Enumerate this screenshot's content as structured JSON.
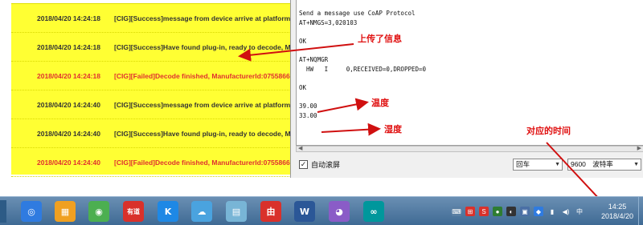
{
  "log": {
    "rows": [
      {
        "timestamp": "2018/04/20 14:24:18",
        "message": "[CIG][Success]message from device arrive at platform, ",
        "status": "success"
      },
      {
        "timestamp": "2018/04/20 14:24:18",
        "message": "[CIG][Success]Have found plug-in, ready to decode, Ma",
        "status": "success"
      },
      {
        "timestamp": "2018/04/20 14:24:18",
        "message": "[CIG][Failed]Decode finished, ManufacturerId:07558661",
        "status": "failed"
      },
      {
        "timestamp": "2018/04/20 14:24:40",
        "message": "[CIG][Success]message from device arrive at platform, ",
        "status": "success"
      },
      {
        "timestamp": "2018/04/20 14:24:40",
        "message": "[CIG][Success]Have found plug-in, ready to decode, Ma",
        "status": "success"
      },
      {
        "timestamp": "2018/04/20 14:24:40",
        "message": "[CIG][Failed]Decode finished, ManufacturerId:07558661",
        "status": "failed"
      }
    ]
  },
  "terminal": {
    "lines": [
      "Send a message use CoAP Protocol",
      "AT+NMGS=3,020103",
      "",
      "OK",
      "",
      "AT+NQMGR",
      "  HW   I     0,RECEIVED=0,DROPPED=0",
      "",
      "OK",
      "",
      "39.00",
      "33.00"
    ],
    "auto_scroll_label": "自动滚屏",
    "auto_scroll_checked": true,
    "line_ending": "回车",
    "baud_value": "9600",
    "baud_label": "波特率"
  },
  "annotations": {
    "uploaded_info": "上传了信息",
    "temperature": "温度",
    "humidity": "湿度",
    "corresponding_time": "对应的时间"
  },
  "taskbar": {
    "apps": [
      {
        "icon": "baidu-netdisk-icon",
        "glyph": "◎",
        "color": "#2f7be0"
      },
      {
        "icon": "app-store-icon",
        "glyph": "▦",
        "color": "#f0a020"
      },
      {
        "icon": "chrome-icon",
        "glyph": "◉",
        "color": "#4caf50"
      },
      {
        "icon": "youdao-dictionary-icon",
        "glyph": "有道",
        "color": "#d9312b"
      },
      {
        "icon": "kugou-icon",
        "glyph": "K",
        "color": "#1e88e5"
      },
      {
        "icon": "cloud-icon",
        "glyph": "☁",
        "color": "#4aa3df"
      },
      {
        "icon": "notes-icon",
        "glyph": "▤",
        "color": "#78b5d6"
      },
      {
        "icon": "app-red-icon",
        "glyph": "由",
        "color": "#d9312b"
      },
      {
        "icon": "word-icon",
        "glyph": "W",
        "color": "#2b5797"
      },
      {
        "icon": "cat-app-icon",
        "glyph": "◕",
        "color": "#8a5cc7"
      },
      {
        "icon": "arduino-icon",
        "glyph": "∞",
        "color": "#00979c"
      }
    ],
    "clock_time": "14:25",
    "clock_date": "2018/4/20"
  },
  "colors": {
    "log_background": "#ffff33",
    "failed_text": "#e03030",
    "annotation_red": "#e01010"
  }
}
